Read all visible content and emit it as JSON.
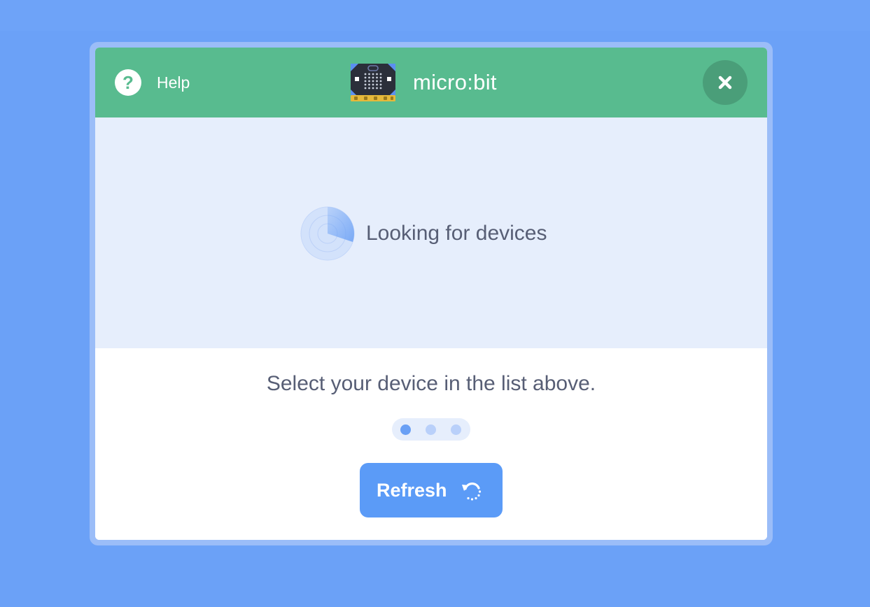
{
  "header": {
    "help_label": "Help",
    "title": "micro:bit",
    "icons": {
      "help": "help-icon",
      "device": "microbit-icon",
      "close": "close-icon"
    }
  },
  "scan": {
    "status_text": "Looking for devices",
    "icon": "radar-icon"
  },
  "footer": {
    "instruction": "Select your device in the list above.",
    "step_indicator": {
      "total_steps": 3,
      "current_step": 1
    },
    "refresh_label": "Refresh",
    "refresh_icon": "refresh-icon"
  },
  "colors": {
    "background": "#6ba1f7",
    "header": "#58bb8f",
    "close_button": "#4a9e79",
    "scan_area": "#e6eefc",
    "text": "#575e75",
    "button": "#5b9bf7"
  }
}
